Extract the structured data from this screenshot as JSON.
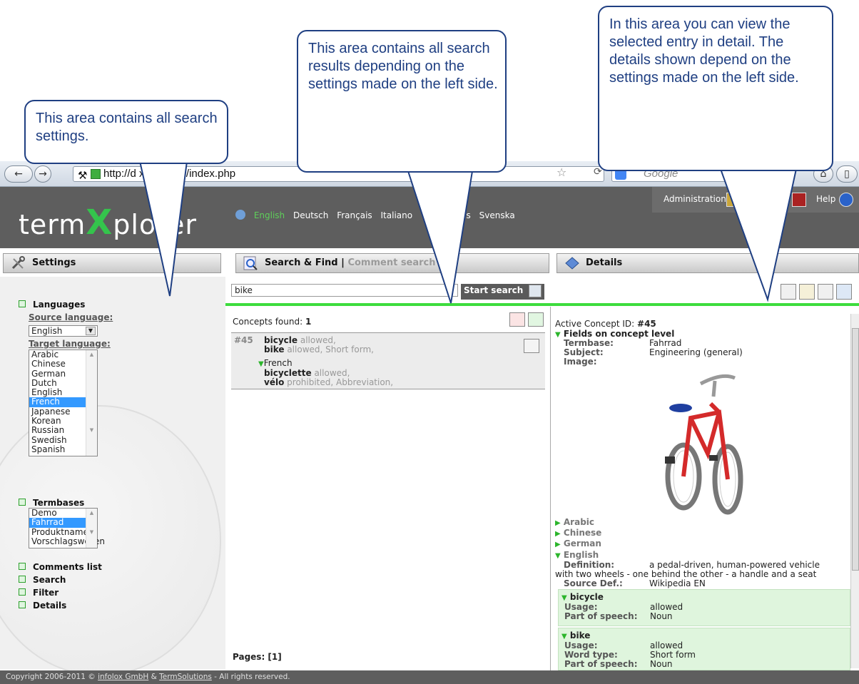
{
  "callouts": {
    "left": "This area contains all search settings.",
    "middle": "This area contains all search results depending on the settings made on the left side.",
    "right": "In this area you can view the selected entry in detail. The details shown depend on the settings made on the left side."
  },
  "browser": {
    "url": "http://d          xplorer.de/index.php",
    "search_placeholder": "Google"
  },
  "app": {
    "logo_left": "term",
    "logo_x": "X",
    "logo_right": "plorer",
    "languages": [
      "English",
      "Deutsch",
      "Français",
      "Italiano",
      "ds",
      "Svenska"
    ],
    "admin_label": "Administration",
    "help_label": "Help"
  },
  "columns": {
    "settings": "Settings",
    "search_find": "Search & Find",
    "separator": "|",
    "comment_search": "Comment search",
    "details": "Details"
  },
  "settings": {
    "languages_label": "Languages",
    "source_label": "Source language:",
    "source_value": "English",
    "target_label": "Target language:",
    "target_options": [
      "Arabic",
      "Chinese",
      "German",
      "Dutch",
      "English",
      "French",
      "Japanese",
      "Korean",
      "Russian",
      "Swedish",
      "Spanish"
    ],
    "target_selected": "French",
    "termbases_label": "Termbases",
    "termbases": [
      "Demo",
      "Fahrrad",
      "Produktnamen",
      "Vorschlagswesen"
    ],
    "termbase_selected": "Fahrrad",
    "comments_label": "Comments list",
    "search_label": "Search",
    "filter_label": "Filter",
    "details_label": "Details"
  },
  "search": {
    "query": "bike",
    "start_label": "Start search",
    "concepts_label": "Concepts found:",
    "concepts_count": "1",
    "pages_label": "Pages: [1]"
  },
  "result": {
    "id": "#45",
    "term1": "bicycle",
    "term1_meta": "allowed,",
    "term2": "bike",
    "term2_meta": "allowed, Short form,",
    "lang": "French",
    "term3": "bicyclette",
    "term3_meta": "allowed,",
    "term4": "vélo",
    "term4_meta": "prohibited, Abbreviation,"
  },
  "details": {
    "active_label": "Active Concept ID:",
    "active_id": "#45",
    "fields_label": "Fields on concept level",
    "termbase_key": "Termbase:",
    "termbase_val": "Fahrrad",
    "subject_key": "Subject:",
    "subject_val": "Engineering (general)",
    "image_key": "Image:",
    "lang_arabic": "Arabic",
    "lang_chinese": "Chinese",
    "lang_german": "German",
    "lang_english": "English",
    "definition_key": "Definition:",
    "definition_val1": "a pedal-driven, human-powered vehicle",
    "definition_val2": "with two wheels - one behind the other - a handle and a seat",
    "source_key": "Source Def.:",
    "source_val": "Wikipedia EN",
    "t1_name": "bicycle",
    "t1_usage_key": "Usage:",
    "t1_usage_val": "allowed",
    "t1_pos_key": "Part of speech:",
    "t1_pos_val": "Noun",
    "t2_name": "bike",
    "t2_usage_key": "Usage:",
    "t2_usage_val": "allowed",
    "t2_wt_key": "Word type:",
    "t2_wt_val": "Short form",
    "t2_pos_key": "Part of speech:",
    "t2_pos_val": "Noun"
  },
  "footer": {
    "prefix": "Copyright 2006-2011 © ",
    "company1": "infolox GmbH",
    "amp": " & ",
    "company2": "TermSolutions",
    "suffix": " - All rights reserved."
  },
  "colors": {
    "accent_green": "#3ddc3d",
    "callout_blue": "#1f3f82",
    "header_gray": "#5e5e5e",
    "selection_blue": "#3399ff"
  }
}
